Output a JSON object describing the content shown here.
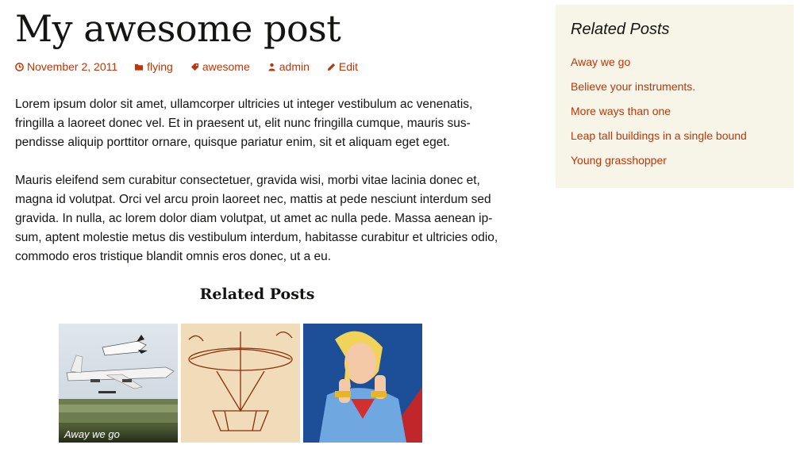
{
  "post": {
    "title": "My awesome post",
    "meta": {
      "date": "November 2, 2011",
      "category": "flying",
      "tag": "awesome",
      "author": "admin",
      "edit": "Edit"
    },
    "paragraphs": [
      "Lorem ipsum dolor sit amet, ullamcorper ultricies ut integer vestibulum ac venenatis, fringilla a laoreet donec vel. Et in praesent ut, elit nunc fringilla cumque, mauris sus-pendisse aliquip porttitor ornare, quisque pariatur enim, sit et aliquam eget eget.",
      "Mauris eleifend sem curabitur consectetuer, gravida wisi, morbi vitae lacinia donec et, magna id volutpat. Orci vel arcu proin laoreet nec, mattis at pede nesciunt interdum sed gravida. In nulla, ac lorem dolor diam volutpat, ut amet ac nulla pede. Massa aenean ip-sum, aptent molestie metus dis vestibulum interdum, habitasse curabitur et ultricies odio, commodo eros tristique blandit omnis eros donec, ut a eu."
    ]
  },
  "related_block": {
    "heading": "Related Posts",
    "thumbs": [
      {
        "caption": "Away we go",
        "image": "space-shuttle-on-jet-photo"
      },
      {
        "caption": "",
        "image": "da-vinci-helicopter-sketch"
      },
      {
        "caption": "",
        "image": "superhero-woman-illustration"
      }
    ]
  },
  "sidebar": {
    "title": "Related Posts",
    "links": [
      "Away we go",
      "Believe your instruments.",
      "More ways than one",
      "Leap tall buildings in a single bound",
      "Young grasshopper"
    ]
  },
  "colors": {
    "accent": "#bc360a",
    "sidebar_bg": "#f7f5e7",
    "text": "#141412"
  }
}
